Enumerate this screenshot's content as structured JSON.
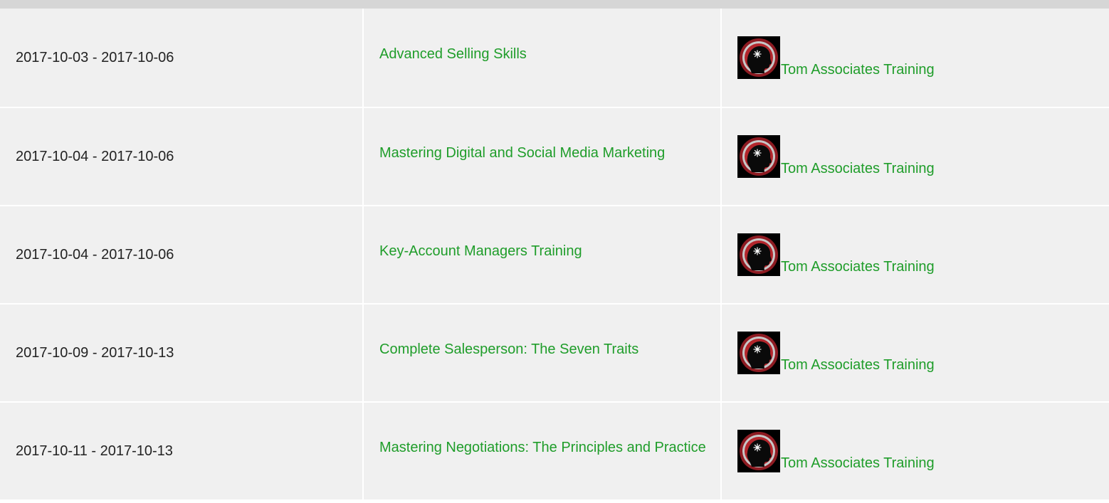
{
  "colors": {
    "link": "#1f9d2a",
    "heading": "#d9262a",
    "cell_background": "#f0f0f0",
    "header_bar": "#d6d6d6",
    "logo_ring": "#a8232a"
  },
  "provider_logo_icon": "head-silhouette-logo",
  "rows": [
    {
      "dates": "2017-10-03 - 2017-10-06",
      "course": "Advanced Selling Skills",
      "provider": "Tom Associates Training"
    },
    {
      "dates": "2017-10-04 - 2017-10-06",
      "course": "Mastering Digital and Social Media Marketing",
      "provider": "Tom Associates Training"
    },
    {
      "dates": "2017-10-04 - 2017-10-06",
      "course": "Key-Account Managers Training",
      "provider": "Tom Associates Training"
    },
    {
      "dates": "2017-10-09 - 2017-10-13",
      "course": "Complete Salesperson: The Seven Traits",
      "provider": "Tom Associates Training"
    },
    {
      "dates": "2017-10-11 - 2017-10-13",
      "course": "Mastering Negotiations: The Principles and Practice",
      "provider": "Tom Associates Training"
    }
  ]
}
